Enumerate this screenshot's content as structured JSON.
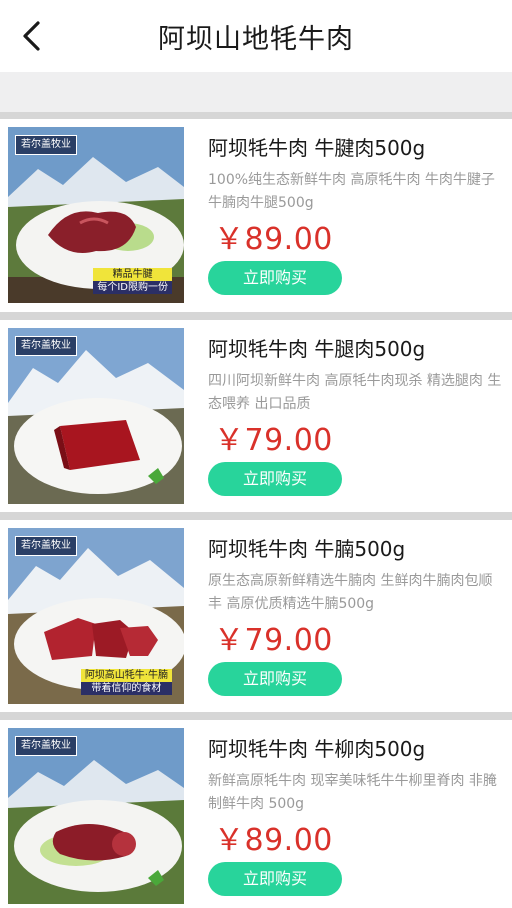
{
  "header": {
    "title": "阿坝山地牦牛肉",
    "back_icon": "chevron-left-icon"
  },
  "colors": {
    "price": "#d9312a",
    "buy_button": "#28d49b",
    "divider": "#d6d6d6",
    "spacer": "#efeff0"
  },
  "products": [
    {
      "title": "阿坝牦牛肉 牛腱肉500g",
      "desc": "100%纯生态新鲜牛肉 高原牦牛肉 牛肉牛腱子牛腩肉牛腿500g",
      "price": "￥89.00",
      "buy_label": "立即购买",
      "brand": "若尔盖牧业",
      "tag_line1": "精品牛腱",
      "tag_line2": "每个ID限购一份"
    },
    {
      "title": "阿坝牦牛肉 牛腿肉500g",
      "desc": "四川阿坝新鲜牛肉 高原牦牛肉现杀 精选腿肉 生态喂养 出口品质",
      "price": "￥79.00",
      "buy_label": "立即购买",
      "brand": "若尔盖牧业"
    },
    {
      "title": "阿坝牦牛肉 牛腩500g",
      "desc": "原生态高原新鲜精选牛腩肉 生鲜肉牛腩肉包顺丰 高原优质精选牛腩500g",
      "price": "￥79.00",
      "buy_label": "立即购买",
      "brand": "若尔盖牧业",
      "tag_line1": "阿坝高山牦牛·牛腩",
      "tag_line2": "带着信仰的食材"
    },
    {
      "title": "阿坝牦牛肉 牛柳肉500g",
      "desc": "新鲜高原牦牛肉 现宰美味牦牛牛柳里脊肉 非腌制鲜牛肉 500g",
      "price": "￥89.00",
      "buy_label": "立即购买",
      "brand": "若尔盖牧业"
    }
  ]
}
